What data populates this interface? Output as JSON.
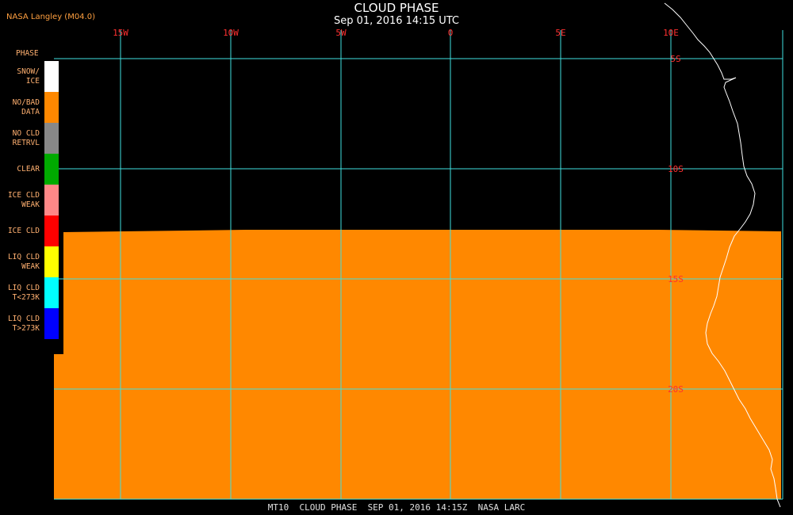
{
  "header": {
    "credit": "NASA Langley (M04.0)",
    "title": "CLOUD PHASE",
    "subtitle": "Sep 01, 2016 14:15 UTC"
  },
  "legend": {
    "title": "PHASE",
    "items": [
      {
        "lines": [
          "SNOW/",
          "ICE"
        ],
        "color": "#ffffff"
      },
      {
        "lines": [
          "NO/BAD",
          "DATA"
        ],
        "color": "#ff8800"
      },
      {
        "lines": [
          "NO CLD",
          "RETRVL"
        ],
        "color": "#888888"
      },
      {
        "lines": [
          "CLEAR"
        ],
        "color": "#00aa00"
      },
      {
        "lines": [
          "ICE CLD",
          "WEAK"
        ],
        "color": "#ff8888"
      },
      {
        "lines": [
          "ICE CLD"
        ],
        "color": "#ff0000"
      },
      {
        "lines": [
          "LIQ CLD",
          "WEAK"
        ],
        "color": "#ffff00"
      },
      {
        "lines": [
          "LIQ CLD",
          "T<273K"
        ],
        "color": "#00ffff"
      },
      {
        "lines": [
          "LIQ CLD",
          "T>273K"
        ],
        "color": "#0000ff"
      }
    ]
  },
  "map": {
    "lon_labels": [
      "15W",
      "10W",
      "5W",
      "0",
      "5E",
      "10E"
    ],
    "lat_labels": [
      "5S",
      "10S",
      "15S",
      "20S"
    ],
    "grid_color": "#40e0e0",
    "coast_color": "#ffffff",
    "fill_color": "#ff8800",
    "background": "#000000"
  },
  "footer": {
    "text": "MT10  CLOUD PHASE  SEP 01, 2016 14:15Z  NASA LARC"
  }
}
